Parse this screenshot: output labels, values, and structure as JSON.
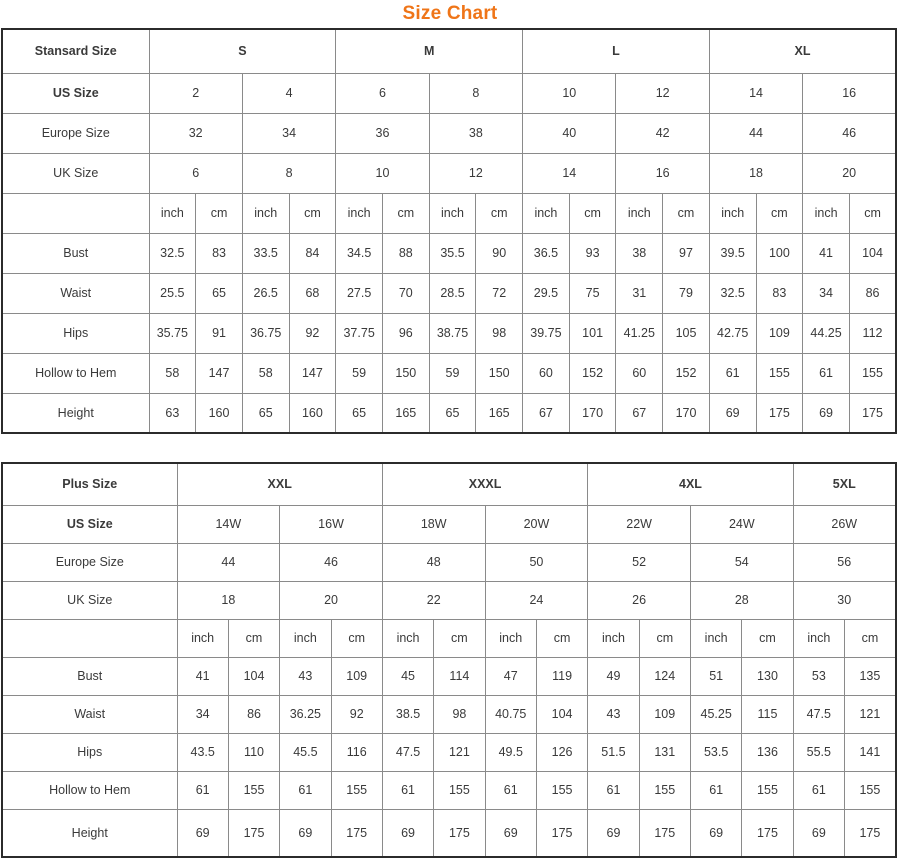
{
  "title": "Size Chart",
  "colors": {
    "title": "#ef7518",
    "outer_border": "#2b2b2b",
    "inner_border": "#8a8a8a",
    "text": "#3a3a3a",
    "background": "#ffffff"
  },
  "units": {
    "inch": "inch",
    "cm": "cm"
  },
  "standard_table": {
    "corner_label": "Stansard Size",
    "groups": [
      "S",
      "M",
      "L",
      "XL"
    ],
    "row_labels": {
      "us": "US Size",
      "europe": "Europe Size",
      "uk": "UK Size",
      "bust": "Bust",
      "waist": "Waist",
      "hips": "Hips",
      "hollow_to_hem": "Hollow to Hem",
      "height": "Height"
    },
    "us_sizes": [
      "2",
      "4",
      "6",
      "8",
      "10",
      "12",
      "14",
      "16"
    ],
    "europe_sizes": [
      "32",
      "34",
      "36",
      "38",
      "40",
      "42",
      "44",
      "46"
    ],
    "uk_sizes": [
      "6",
      "8",
      "10",
      "12",
      "14",
      "16",
      "18",
      "20"
    ],
    "measurements": {
      "bust": {
        "inch": [
          "32.5",
          "33.5",
          "34.5",
          "35.5",
          "36.5",
          "38",
          "39.5",
          "41"
        ],
        "cm": [
          "83",
          "84",
          "88",
          "90",
          "93",
          "97",
          "100",
          "104"
        ]
      },
      "waist": {
        "inch": [
          "25.5",
          "26.5",
          "27.5",
          "28.5",
          "29.5",
          "31",
          "32.5",
          "34"
        ],
        "cm": [
          "65",
          "68",
          "70",
          "72",
          "75",
          "79",
          "83",
          "86"
        ]
      },
      "hips": {
        "inch": [
          "35.75",
          "36.75",
          "37.75",
          "38.75",
          "39.75",
          "41.25",
          "42.75",
          "44.25"
        ],
        "cm": [
          "91",
          "92",
          "96",
          "98",
          "101",
          "105",
          "109",
          "112"
        ]
      },
      "hollow_to_hem": {
        "inch": [
          "58",
          "58",
          "59",
          "59",
          "60",
          "60",
          "61",
          "61"
        ],
        "cm": [
          "147",
          "147",
          "150",
          "150",
          "152",
          "152",
          "155",
          "155"
        ]
      },
      "height": {
        "inch": [
          "63",
          "65",
          "65",
          "65",
          "67",
          "67",
          "69",
          "69"
        ],
        "cm": [
          "160",
          "160",
          "165",
          "165",
          "170",
          "170",
          "175",
          "175"
        ]
      }
    }
  },
  "plus_table": {
    "corner_label": "Plus Size",
    "groups": [
      "XXL",
      "XXXL",
      "4XL",
      "5XL"
    ],
    "row_labels": {
      "us": "US Size",
      "europe": "Europe Size",
      "uk": "UK Size",
      "bust": "Bust",
      "waist": "Waist",
      "hips": "Hips",
      "hollow_to_hem": "Hollow to Hem",
      "height": "Height"
    },
    "us_sizes": [
      "14W",
      "16W",
      "18W",
      "20W",
      "22W",
      "24W",
      "26W"
    ],
    "europe_sizes": [
      "44",
      "46",
      "48",
      "50",
      "52",
      "54",
      "56"
    ],
    "uk_sizes": [
      "18",
      "20",
      "22",
      "24",
      "26",
      "28",
      "30"
    ],
    "measurements": {
      "bust": {
        "inch": [
          "41",
          "43",
          "45",
          "47",
          "49",
          "51",
          "53"
        ],
        "cm": [
          "104",
          "109",
          "114",
          "119",
          "124",
          "130",
          "135"
        ]
      },
      "waist": {
        "inch": [
          "34",
          "36.25",
          "38.5",
          "40.75",
          "43",
          "45.25",
          "47.5"
        ],
        "cm": [
          "86",
          "92",
          "98",
          "104",
          "109",
          "115",
          "121"
        ]
      },
      "hips": {
        "inch": [
          "43.5",
          "45.5",
          "47.5",
          "49.5",
          "51.5",
          "53.5",
          "55.5"
        ],
        "cm": [
          "110",
          "116",
          "121",
          "126",
          "131",
          "136",
          "141"
        ]
      },
      "hollow_to_hem": {
        "inch": [
          "61",
          "61",
          "61",
          "61",
          "61",
          "61",
          "61"
        ],
        "cm": [
          "155",
          "155",
          "155",
          "155",
          "155",
          "155",
          "155"
        ]
      },
      "height": {
        "inch": [
          "69",
          "69",
          "69",
          "69",
          "69",
          "69",
          "69"
        ],
        "cm": [
          "175",
          "175",
          "175",
          "175",
          "175",
          "175",
          "175"
        ]
      }
    }
  }
}
